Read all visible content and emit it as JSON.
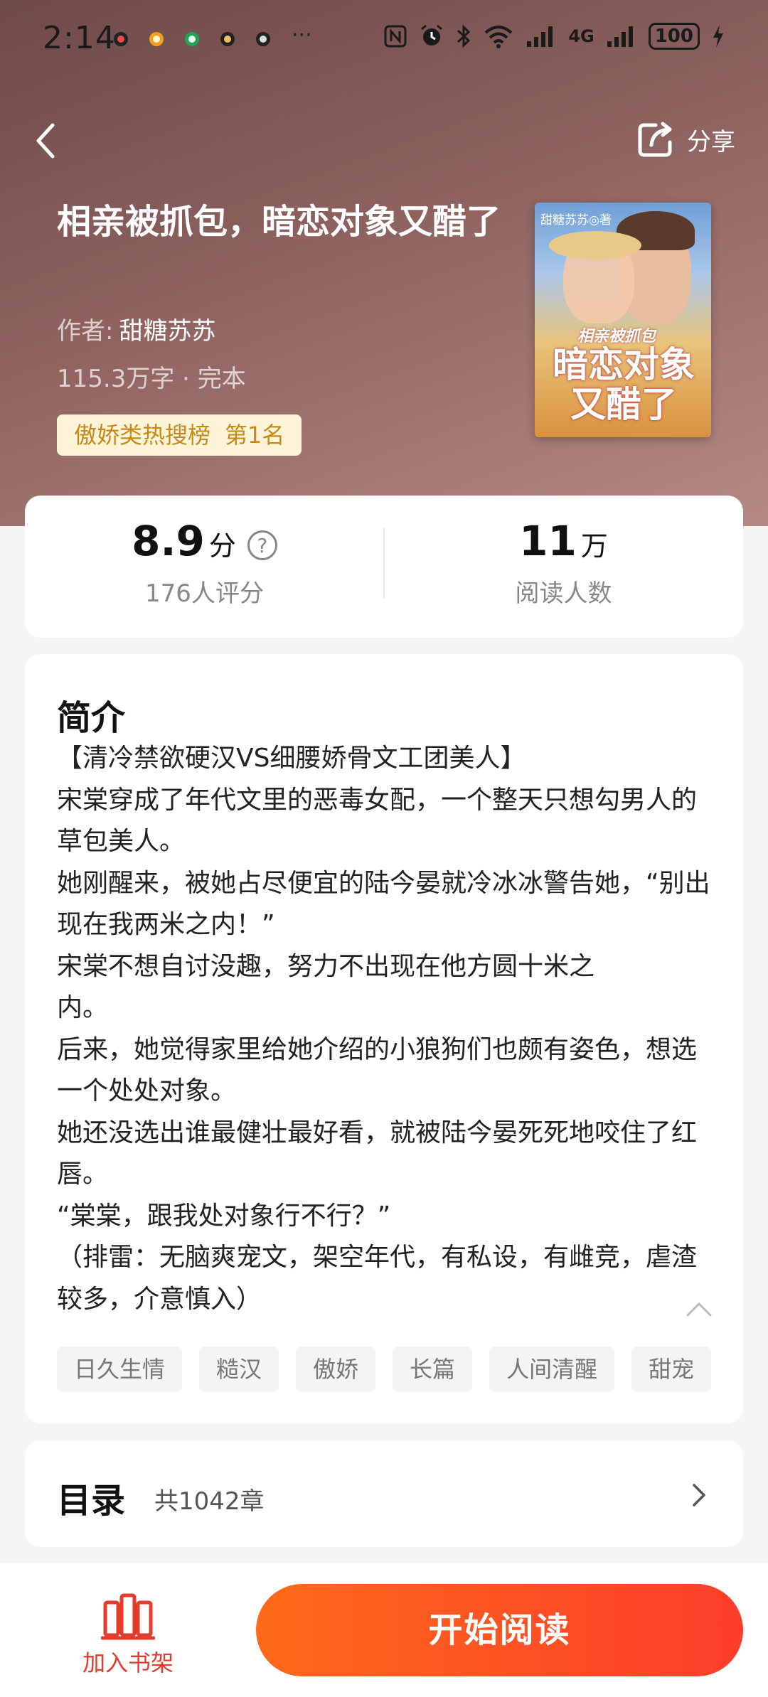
{
  "status_bar": {
    "time": "2:14",
    "more": "···",
    "network": "4G",
    "battery": "100"
  },
  "header": {
    "share_label": "分享"
  },
  "book": {
    "title": "相亲被抓包，暗恋对象又醋了",
    "author_prefix": "作者:",
    "author": "甜糖苏苏",
    "meta": "115.3万字 · 完本",
    "rank_category": "傲娇类热搜榜",
    "rank_position": "第1名",
    "cover": {
      "author_text": "甜糖苏苏◎著",
      "subtitle": "相亲被抓包",
      "main_title": "暗恋对象又醋了"
    }
  },
  "stats": {
    "rating_value": "8.9",
    "rating_unit": "分",
    "rating_label": "176人评分",
    "readers_value": "11",
    "readers_unit": "万",
    "readers_label": "阅读人数"
  },
  "intro": {
    "title": "简介",
    "lines": [
      "【清冷禁欲硬汉VS细腰娇骨文工团美人】",
      "宋棠穿成了年代文里的恶毒女配，一个整天只想勾男人的草包美人。",
      "她刚醒来，被她占尽便宜的陆今晏就冷冰冰警告她，“别出现在我两米之内！”",
      "宋棠不想自讨没趣，努力不出现在他方圆十米之\n内。",
      "后来，她觉得家里给她介绍的小狼狗们也颇有姿色，想选一个处处对象。",
      "她还没选出谁最健壮最好看，就被陆今晏死死地咬住了红唇。",
      "“棠棠，跟我处对象行不行？”",
      "（排雷：无脑爽宠文，架空年代，有私设，有雌竞，虐渣较多，介意慎入）"
    ],
    "tags": [
      "日久生情",
      "糙汉",
      "傲娇",
      "长篇",
      "人间清醒",
      "甜宠"
    ]
  },
  "toc": {
    "title": "目录",
    "count": "共1042章"
  },
  "bottom": {
    "shelf_label": "加入书架",
    "read_label": "开始阅读"
  },
  "colors": {
    "accent": "#fd3d2b",
    "hero_bg": "#8d625f",
    "rank_text": "#c7881a"
  }
}
